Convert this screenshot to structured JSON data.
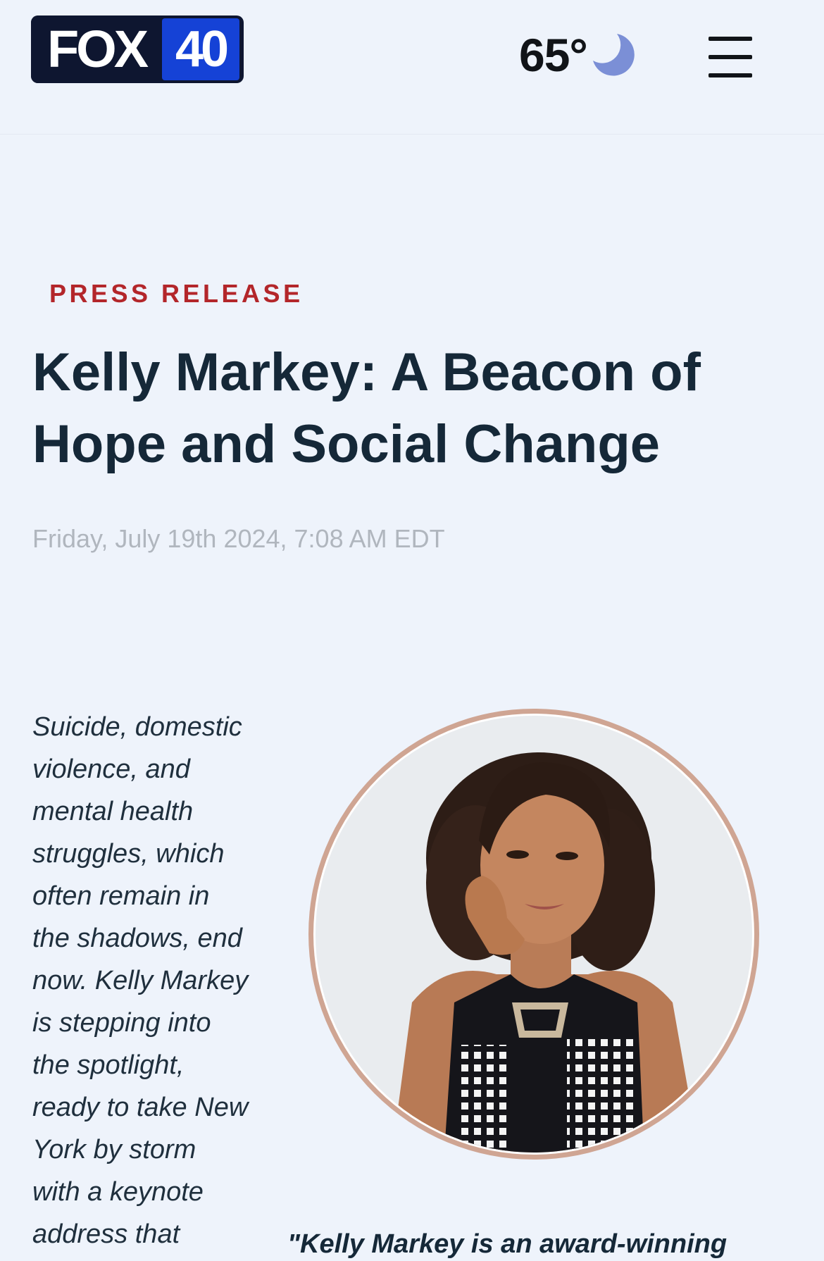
{
  "header": {
    "logo": {
      "brand": "FOX",
      "number": "40"
    },
    "weather": {
      "temperature": "65°",
      "icon": "moon-icon"
    },
    "menu_icon": "hamburger-menu-icon"
  },
  "article": {
    "category": "PRESS RELEASE",
    "title": "Kelly Markey: A Beacon of Hope and Social Change",
    "dateline": "Friday, July 19th 2024, 7:08 AM EDT",
    "intro_lines": [
      "Suicide, domestic",
      "violence, and",
      "mental health",
      "struggles, which",
      "often remain in",
      "the shadows, end",
      "now. Kelly Markey",
      "is stepping into",
      "the spotlight,",
      "ready to take New",
      "York by storm",
      "with a keynote",
      "address that"
    ],
    "quote_start": "\"Kelly Markey is an award-winning"
  },
  "colors": {
    "background": "#eef3fb",
    "category_red": "#b3262a",
    "headline_navy": "#152838",
    "logo_navy": "#0e1630",
    "logo_blue": "#1542d6",
    "moon_blue": "#7b8fd6",
    "portrait_ring": "#cfa593"
  }
}
